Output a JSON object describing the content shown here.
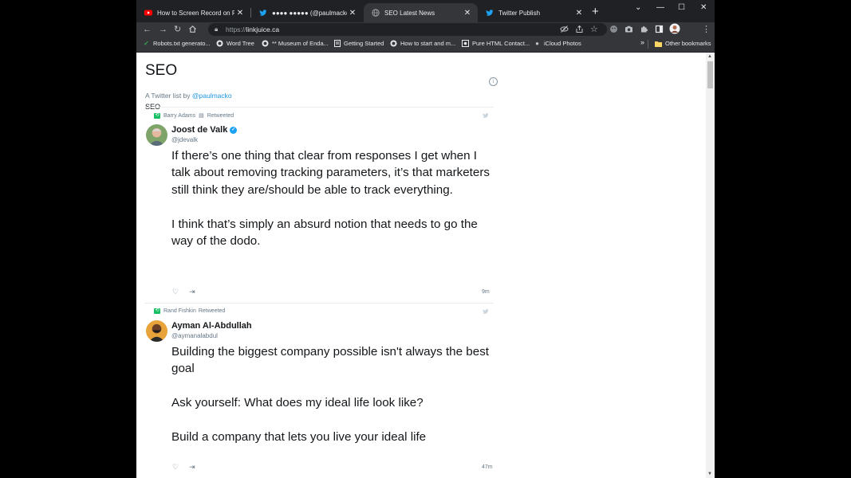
{
  "browser": {
    "tabs": [
      {
        "title": "How to Screen Record on PC - Y",
        "icon": "youtube-icon",
        "color": "#ff0000"
      },
      {
        "title": "●●●● ●●●●● (@paulmacko",
        "icon": "twitter-icon",
        "color": "#1da1f2"
      },
      {
        "title": "SEO Latest News",
        "icon": "globe-icon",
        "color": "#9aa0a6"
      },
      {
        "title": "Twitter Publish",
        "icon": "twitter-icon",
        "color": "#1da1f2"
      }
    ],
    "new_tab": "+",
    "window_controls": {
      "minimize": "—",
      "maximize": "☐",
      "close": "✕",
      "tab_search": "⌄"
    },
    "url_scheme": "https://",
    "url_host": "linkjuice.ca",
    "bookmarks": [
      "Robots.txt generato...",
      "Word Tree",
      "** Museum of Enda...",
      "Getting Started",
      "How to start and m...",
      "Pure HTML Contact...",
      "iCloud Photos"
    ],
    "bookmarks_overflow": "»",
    "other_bookmarks": "Other bookmarks"
  },
  "list": {
    "title": "SEO",
    "subtitle_prefix": "A Twitter list by ",
    "owner": "@paulmacko",
    "description": "SEO"
  },
  "tweets": [
    {
      "retweeted_by": "Barry Adams",
      "retweeted_label": "Retweeted",
      "name": "Joost de Valk",
      "verified": true,
      "handle": "@jdevalk",
      "text": "If there’s one thing that clear from responses I get when I talk about removing tracking parameters, it’s that marketers still think they are/should be able to track everything.\n\nI think that’s simply an absurd notion that needs to go the way of the dodo.",
      "time": "9m"
    },
    {
      "retweeted_by": "Rand Fishkin",
      "retweeted_label": "Retweeted",
      "name": "Ayman Al-Abdullah",
      "verified": false,
      "handle": "@aymanalabdul",
      "text": "Building the biggest company possible isn't always the best goal\n\nAsk yourself: What does my ideal life look like?\n\nBuild a company that lets you live your ideal life",
      "time": "47m"
    }
  ],
  "icons": {
    "like": "♡",
    "share": "⇥"
  }
}
